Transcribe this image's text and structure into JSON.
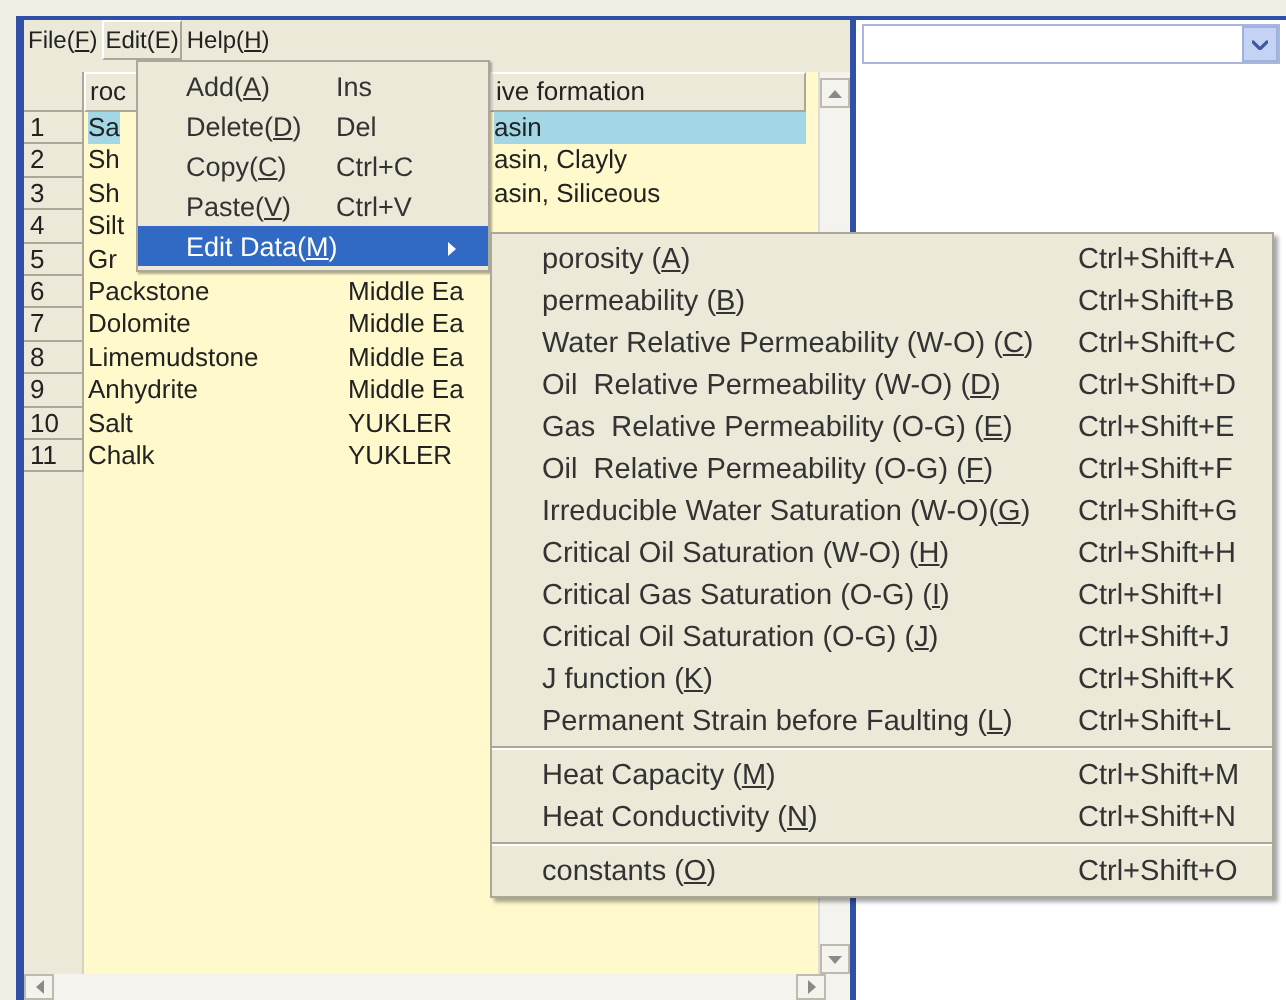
{
  "menu_bar": [
    {
      "before": "File(",
      "mnemonic": "F",
      "after": ")",
      "selected": false
    },
    {
      "before": "Edit(E)",
      "selected": true
    },
    {
      "before": "Help(",
      "mnemonic": "H",
      "after": ")",
      "selected": false
    }
  ],
  "grid": {
    "column_headers": {
      "column_1": "roc",
      "column_3": "ive formation"
    },
    "rows": [
      {
        "number": "1",
        "column_1": "Sa",
        "column_3": "asin",
        "selected": true
      },
      {
        "number": "2",
        "column_1": "Sh",
        "column_3": "asin, Clayly",
        "selected": false
      },
      {
        "number": "3",
        "column_1": "Sh",
        "column_3": "asin, Siliceous",
        "selected": false
      },
      {
        "number": "4",
        "column_1": "Silt",
        "selected": false
      },
      {
        "number": "5",
        "column_1": "Gr",
        "selected": false
      },
      {
        "number": "6",
        "column_1": "Packstone",
        "column_2": "Middle Ea",
        "selected": false
      },
      {
        "number": "7",
        "column_1": "Dolomite",
        "column_2": "Middle Ea",
        "selected": false
      },
      {
        "number": "8",
        "column_1": "Limemudstone",
        "column_2": "Middle Ea",
        "selected": false
      },
      {
        "number": "9",
        "column_1": "Anhydrite",
        "column_2": "Middle Ea",
        "selected": false
      },
      {
        "number": "10",
        "column_1": "Salt",
        "column_2": "YUKLER",
        "selected": false
      },
      {
        "number": "11",
        "column_1": "Chalk",
        "column_2": "YUKLER",
        "selected": false
      }
    ]
  },
  "edit_menu": {
    "items": [
      {
        "before": "Add(",
        "mnemonic": "A",
        "after": ")",
        "shortcut": "Ins",
        "selected": false,
        "submenu": false
      },
      {
        "before": "Delete(",
        "mnemonic": "D",
        "after": ")",
        "shortcut": "Del",
        "selected": false,
        "submenu": false
      },
      {
        "before": "Copy(",
        "mnemonic": "C",
        "after": ")",
        "shortcut": "Ctrl+C",
        "selected": false,
        "submenu": false
      },
      {
        "before": "Paste(",
        "mnemonic": "V",
        "after": ")",
        "shortcut": "Ctrl+V",
        "selected": false,
        "submenu": false
      },
      {
        "before": "Edit Data(",
        "mnemonic": "M",
        "after": ")",
        "selected": true,
        "submenu": true
      }
    ]
  },
  "edit_data_menu": {
    "items": [
      {
        "before": "porosity (",
        "mnemonic": "A",
        "after": ")",
        "shortcut": "Ctrl+Shift+A",
        "separator_before": false
      },
      {
        "before": "permeability (",
        "mnemonic": "B",
        "after": ")",
        "shortcut": "Ctrl+Shift+B",
        "separator_before": false
      },
      {
        "before": "Water Relative Permeability (W-O) (",
        "mnemonic": "C",
        "after": ")",
        "shortcut": "Ctrl+Shift+C",
        "separator_before": false
      },
      {
        "before": "Oil  Relative Permeability (W-O) (",
        "mnemonic": "D",
        "after": ")",
        "shortcut": "Ctrl+Shift+D",
        "separator_before": false
      },
      {
        "before": "Gas  Relative Permeability (O-G) (",
        "mnemonic": "E",
        "after": ")",
        "shortcut": "Ctrl+Shift+E",
        "separator_before": false
      },
      {
        "before": "Oil  Relative Permeability (O-G) (",
        "mnemonic": "F",
        "after": ")",
        "shortcut": "Ctrl+Shift+F",
        "separator_before": false
      },
      {
        "before": "Irreducible Water Saturation (W-O)(",
        "mnemonic": "G",
        "after": ")",
        "shortcut": "Ctrl+Shift+G",
        "separator_before": false
      },
      {
        "before": "Critical Oil Saturation (W-O) (",
        "mnemonic": "H",
        "after": ")",
        "shortcut": "Ctrl+Shift+H",
        "separator_before": false
      },
      {
        "before": "Critical Gas Saturation (O-G) (",
        "mnemonic": "I",
        "after": ")",
        "shortcut": "Ctrl+Shift+I",
        "separator_before": false
      },
      {
        "before": "Critical Oil Saturation (O-G) (",
        "mnemonic": "J",
        "after": ")",
        "shortcut": "Ctrl+Shift+J",
        "separator_before": false
      },
      {
        "before": "J function (",
        "mnemonic": "K",
        "after": ")",
        "shortcut": "Ctrl+Shift+K",
        "separator_before": false
      },
      {
        "before": "Permanent Strain before Faulting (",
        "mnemonic": "L",
        "after": ")",
        "shortcut": "Ctrl+Shift+L",
        "separator_before": false
      },
      {
        "before": "Heat Capacity (",
        "mnemonic": "M",
        "after": ")",
        "shortcut": "Ctrl+Shift+M",
        "separator_before": true
      },
      {
        "before": "Heat Conductivity (",
        "mnemonic": "N",
        "after": ")",
        "shortcut": "Ctrl+Shift+N",
        "separator_before": false
      },
      {
        "before": "constants (",
        "mnemonic": "O",
        "after": ")",
        "shortcut": "Ctrl+Shift+O",
        "separator_before": true
      }
    ]
  }
}
